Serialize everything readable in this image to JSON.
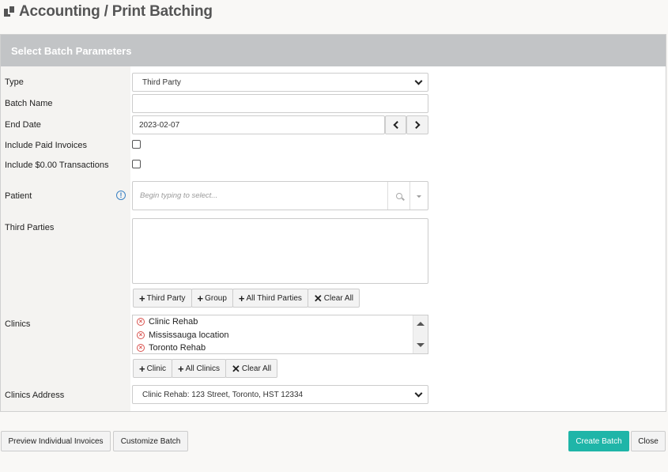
{
  "page": {
    "title": "Accounting / Print Batching",
    "icon": "copy-docs-icon"
  },
  "panel": {
    "heading": "Select Batch Parameters"
  },
  "form": {
    "type": {
      "label": "Type",
      "value": "Third Party"
    },
    "batch_name": {
      "label": "Batch Name",
      "value": ""
    },
    "end_date": {
      "label": "End Date",
      "value": "2023-02-07"
    },
    "include_paid": {
      "label": "Include Paid Invoices",
      "checked": false
    },
    "include_zero": {
      "label": "Include $0.00 Transactions",
      "checked": false
    },
    "patient": {
      "label": "Patient",
      "placeholder": "Begin typing to select..."
    },
    "third_parties": {
      "label": "Third Parties",
      "buttons": {
        "third_party": "Third Party",
        "group": "Group",
        "all": "All Third Parties",
        "clear": "Clear All"
      }
    },
    "clinics": {
      "label": "Clinics",
      "items": [
        "Clinic Rehab",
        "Mississauga location",
        "Toronto Rehab"
      ],
      "buttons": {
        "clinic": "Clinic",
        "all": "All Clinics",
        "clear": "Clear All"
      }
    },
    "clinics_address": {
      "label": "Clinics Address",
      "value": "Clinic Rehab: 123 Street, Toronto, HST 12334"
    }
  },
  "footer": {
    "preview": "Preview Individual Invoices",
    "customize": "Customize Batch",
    "create": "Create Batch",
    "close": "Close"
  },
  "colors": {
    "primary": "#1fb5a8",
    "panel_heading": "#c2c4c6",
    "info": "#3b82c4",
    "remove": "#d9534f"
  }
}
